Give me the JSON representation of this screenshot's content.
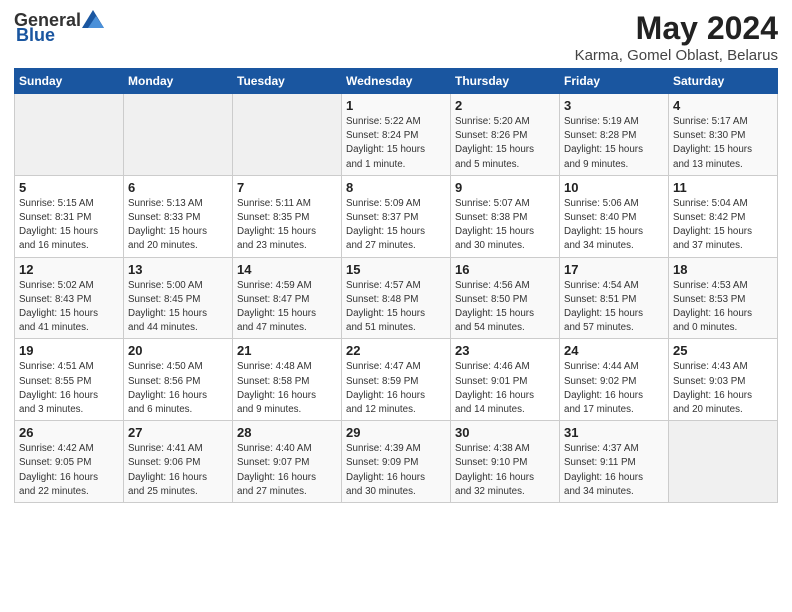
{
  "header": {
    "logo_general": "General",
    "logo_blue": "Blue",
    "month_year": "May 2024",
    "location": "Karma, Gomel Oblast, Belarus"
  },
  "days_of_week": [
    "Sunday",
    "Monday",
    "Tuesday",
    "Wednesday",
    "Thursday",
    "Friday",
    "Saturday"
  ],
  "weeks": [
    [
      {
        "num": "",
        "detail": ""
      },
      {
        "num": "",
        "detail": ""
      },
      {
        "num": "",
        "detail": ""
      },
      {
        "num": "1",
        "detail": "Sunrise: 5:22 AM\nSunset: 8:24 PM\nDaylight: 15 hours\nand 1 minute."
      },
      {
        "num": "2",
        "detail": "Sunrise: 5:20 AM\nSunset: 8:26 PM\nDaylight: 15 hours\nand 5 minutes."
      },
      {
        "num": "3",
        "detail": "Sunrise: 5:19 AM\nSunset: 8:28 PM\nDaylight: 15 hours\nand 9 minutes."
      },
      {
        "num": "4",
        "detail": "Sunrise: 5:17 AM\nSunset: 8:30 PM\nDaylight: 15 hours\nand 13 minutes."
      }
    ],
    [
      {
        "num": "5",
        "detail": "Sunrise: 5:15 AM\nSunset: 8:31 PM\nDaylight: 15 hours\nand 16 minutes."
      },
      {
        "num": "6",
        "detail": "Sunrise: 5:13 AM\nSunset: 8:33 PM\nDaylight: 15 hours\nand 20 minutes."
      },
      {
        "num": "7",
        "detail": "Sunrise: 5:11 AM\nSunset: 8:35 PM\nDaylight: 15 hours\nand 23 minutes."
      },
      {
        "num": "8",
        "detail": "Sunrise: 5:09 AM\nSunset: 8:37 PM\nDaylight: 15 hours\nand 27 minutes."
      },
      {
        "num": "9",
        "detail": "Sunrise: 5:07 AM\nSunset: 8:38 PM\nDaylight: 15 hours\nand 30 minutes."
      },
      {
        "num": "10",
        "detail": "Sunrise: 5:06 AM\nSunset: 8:40 PM\nDaylight: 15 hours\nand 34 minutes."
      },
      {
        "num": "11",
        "detail": "Sunrise: 5:04 AM\nSunset: 8:42 PM\nDaylight: 15 hours\nand 37 minutes."
      }
    ],
    [
      {
        "num": "12",
        "detail": "Sunrise: 5:02 AM\nSunset: 8:43 PM\nDaylight: 15 hours\nand 41 minutes."
      },
      {
        "num": "13",
        "detail": "Sunrise: 5:00 AM\nSunset: 8:45 PM\nDaylight: 15 hours\nand 44 minutes."
      },
      {
        "num": "14",
        "detail": "Sunrise: 4:59 AM\nSunset: 8:47 PM\nDaylight: 15 hours\nand 47 minutes."
      },
      {
        "num": "15",
        "detail": "Sunrise: 4:57 AM\nSunset: 8:48 PM\nDaylight: 15 hours\nand 51 minutes."
      },
      {
        "num": "16",
        "detail": "Sunrise: 4:56 AM\nSunset: 8:50 PM\nDaylight: 15 hours\nand 54 minutes."
      },
      {
        "num": "17",
        "detail": "Sunrise: 4:54 AM\nSunset: 8:51 PM\nDaylight: 15 hours\nand 57 minutes."
      },
      {
        "num": "18",
        "detail": "Sunrise: 4:53 AM\nSunset: 8:53 PM\nDaylight: 16 hours\nand 0 minutes."
      }
    ],
    [
      {
        "num": "19",
        "detail": "Sunrise: 4:51 AM\nSunset: 8:55 PM\nDaylight: 16 hours\nand 3 minutes."
      },
      {
        "num": "20",
        "detail": "Sunrise: 4:50 AM\nSunset: 8:56 PM\nDaylight: 16 hours\nand 6 minutes."
      },
      {
        "num": "21",
        "detail": "Sunrise: 4:48 AM\nSunset: 8:58 PM\nDaylight: 16 hours\nand 9 minutes."
      },
      {
        "num": "22",
        "detail": "Sunrise: 4:47 AM\nSunset: 8:59 PM\nDaylight: 16 hours\nand 12 minutes."
      },
      {
        "num": "23",
        "detail": "Sunrise: 4:46 AM\nSunset: 9:01 PM\nDaylight: 16 hours\nand 14 minutes."
      },
      {
        "num": "24",
        "detail": "Sunrise: 4:44 AM\nSunset: 9:02 PM\nDaylight: 16 hours\nand 17 minutes."
      },
      {
        "num": "25",
        "detail": "Sunrise: 4:43 AM\nSunset: 9:03 PM\nDaylight: 16 hours\nand 20 minutes."
      }
    ],
    [
      {
        "num": "26",
        "detail": "Sunrise: 4:42 AM\nSunset: 9:05 PM\nDaylight: 16 hours\nand 22 minutes."
      },
      {
        "num": "27",
        "detail": "Sunrise: 4:41 AM\nSunset: 9:06 PM\nDaylight: 16 hours\nand 25 minutes."
      },
      {
        "num": "28",
        "detail": "Sunrise: 4:40 AM\nSunset: 9:07 PM\nDaylight: 16 hours\nand 27 minutes."
      },
      {
        "num": "29",
        "detail": "Sunrise: 4:39 AM\nSunset: 9:09 PM\nDaylight: 16 hours\nand 30 minutes."
      },
      {
        "num": "30",
        "detail": "Sunrise: 4:38 AM\nSunset: 9:10 PM\nDaylight: 16 hours\nand 32 minutes."
      },
      {
        "num": "31",
        "detail": "Sunrise: 4:37 AM\nSunset: 9:11 PM\nDaylight: 16 hours\nand 34 minutes."
      },
      {
        "num": "",
        "detail": ""
      }
    ]
  ]
}
